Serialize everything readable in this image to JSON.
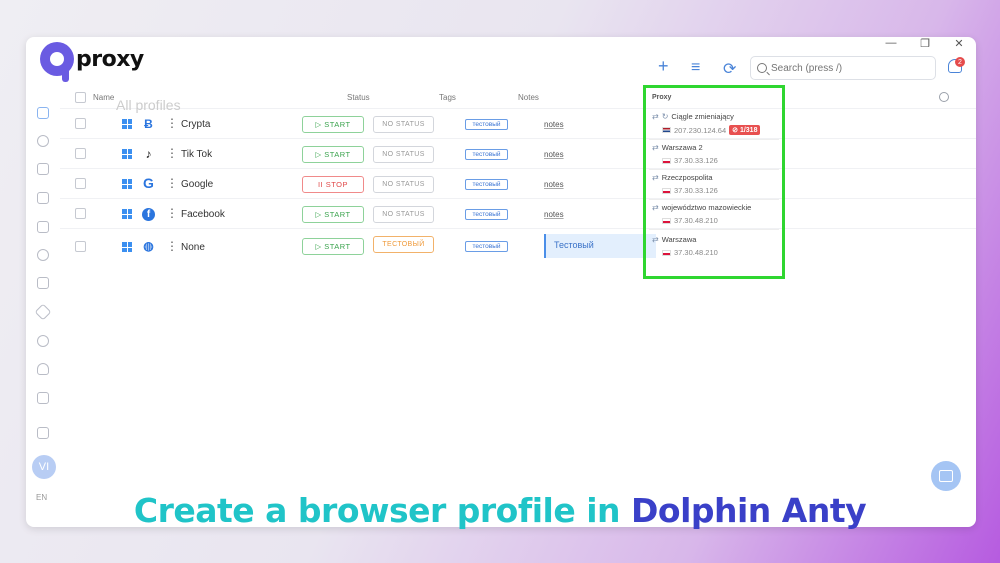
{
  "app": {
    "logo_text": "proxy",
    "ghost_title": "All profiles"
  },
  "window_controls": [
    "—",
    "❐",
    "✕"
  ],
  "toolbar": {
    "add_icon": "+",
    "filter_icon": "≡",
    "refresh_icon": "⟳",
    "search_placeholder": "Search (press /)",
    "notification_count": "2"
  },
  "table": {
    "headers": {
      "name": "Name",
      "status": "Status",
      "tags": "Tags",
      "notes": "Notes",
      "proxy": "Proxy"
    },
    "rows": [
      {
        "icon": "Ƀ",
        "name": "Crypta",
        "action": "▷ START",
        "action_type": "start",
        "status": "NO STATUS",
        "tag": "тестовый",
        "notes": "notes"
      },
      {
        "icon": "♪",
        "name": "Tik Tok",
        "action": "▷ START",
        "action_type": "start",
        "status": "NO STATUS",
        "tag": "тестовый",
        "notes": "notes"
      },
      {
        "icon": "G",
        "name": "Google",
        "action": "II STOP",
        "action_type": "stop",
        "status": "NO STATUS",
        "tag": "тестовый",
        "notes": "notes"
      },
      {
        "icon": "f",
        "name": "Facebook",
        "action": "▷ START",
        "action_type": "start",
        "status": "NO STATUS",
        "tag": "тестовый",
        "notes": "notes"
      },
      {
        "icon": "◍",
        "name": "None",
        "action": "▷ START",
        "action_type": "start",
        "status": "ТЕСТОВЫЙ",
        "tag": "тестовый",
        "notes": "Тестовый"
      }
    ]
  },
  "proxies": [
    {
      "name": "Ciągle zmieniający",
      "ip": "207.230.124.64",
      "flag": "nl",
      "limit": "⊘ 1/318"
    },
    {
      "name": "Warszawa 2",
      "ip": "37.30.33.126",
      "flag": "pl"
    },
    {
      "name": "Rzeczpospolita",
      "ip": "37.30.33.126",
      "flag": "pl"
    },
    {
      "name": "województwo mazowieckie",
      "ip": "37.30.48.210",
      "flag": "pl"
    },
    {
      "name": "Warszawa",
      "ip": "37.30.48.210",
      "flag": "pl"
    }
  ],
  "user": {
    "avatar": "VI",
    "lang": "EN"
  },
  "caption": {
    "part1": "Create a browser profile in ",
    "part2": "Dolphin Anty"
  },
  "colors": {
    "accent": "#4a84d8",
    "highlight": "#2fd630",
    "caption_teal": "#20c4c8",
    "caption_navy": "#3a40c8"
  }
}
